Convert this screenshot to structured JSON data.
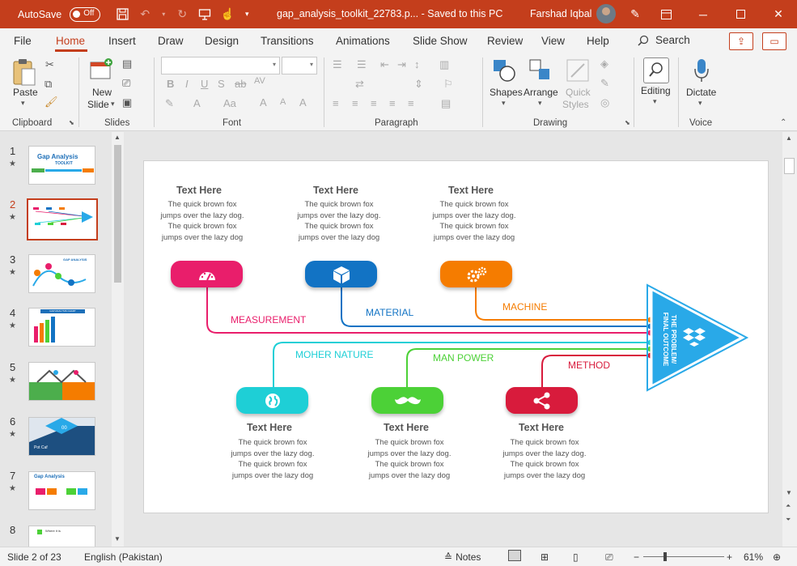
{
  "titlebar": {
    "autosave_label": "AutoSave",
    "autosave_state": "Off",
    "doc_title": "gap_analysis_toolkit_22783.p... - Saved to this PC",
    "user_name": "Farshad Iqbal"
  },
  "menu": {
    "tabs": [
      "File",
      "Home",
      "Insert",
      "Draw",
      "Design",
      "Transitions",
      "Animations",
      "Slide Show",
      "Review",
      "View",
      "Help"
    ],
    "active": "Home",
    "search_label": "Search"
  },
  "ribbon": {
    "clipboard": {
      "paste": "Paste",
      "group": "Clipboard"
    },
    "slides": {
      "new_slide_line1": "New",
      "new_slide_line2": "Slide",
      "group": "Slides"
    },
    "font": {
      "group": "Font"
    },
    "paragraph": {
      "group": "Paragraph"
    },
    "drawing": {
      "shapes": "Shapes",
      "arrange": "Arrange",
      "quick_line1": "Quick",
      "quick_line2": "Styles",
      "group": "Drawing"
    },
    "editing": {
      "label": "Editing"
    },
    "voice": {
      "dictate": "Dictate",
      "group": "Voice"
    }
  },
  "thumbnails": {
    "numbers": [
      "1",
      "2",
      "3",
      "4",
      "5",
      "6",
      "7",
      "8"
    ],
    "active_index": 1,
    "t1_title": "Gap Analysis",
    "t1_sub": "TOOLKIT",
    "t3_title": "GAP ANALYSIS",
    "t4_title": "GAP ANALYSIS CHART",
    "t6_label1": "Pot Caf",
    "t6_label2": "00",
    "t7_title": "Gap Analysis",
    "t8_title": "Where it is"
  },
  "slide": {
    "top_blocks": [
      {
        "heading": "Text Here",
        "body": "The quick brown fox jumps over the lazy dog. The quick brown fox jumps over the lazy dog",
        "color": "#e91e6b",
        "icon": "gauge-icon",
        "category": "MEASUREMENT"
      },
      {
        "heading": "Text Here",
        "body": "The quick brown fox jumps over the lazy dog. The quick brown fox jumps over the lazy dog",
        "color": "#1273c4",
        "icon": "cube-icon",
        "category": "MATERIAL"
      },
      {
        "heading": "Text Here",
        "body": "The quick brown fox jumps over the lazy dog. The quick brown fox jumps over the lazy dog",
        "color": "#f57c00",
        "icon": "gears-icon",
        "category": "MACHINE"
      }
    ],
    "bottom_blocks": [
      {
        "heading": "Text Here",
        "body": "The quick brown fox jumps over the lazy dog. The quick brown fox jumps over the lazy dog",
        "color": "#1ecfd6",
        "icon": "globe-icon",
        "category": "MOHER NATURE"
      },
      {
        "heading": "Text Here",
        "body": "The quick brown fox jumps over the lazy dog. The quick brown fox jumps over the lazy dog",
        "color": "#4cd137",
        "icon": "mustache-icon",
        "category": "MAN POWER"
      },
      {
        "heading": "Text Here",
        "body": "The quick brown fox jumps over the lazy dog. The quick brown fox jumps over the lazy dog",
        "color": "#d81b3c",
        "icon": "share-icon",
        "category": "METHOD"
      }
    ],
    "outcome_line1": "THE PROBLEM/",
    "outcome_line2": "FINAL OUTCOME",
    "outcome_color": "#29a9e8"
  },
  "status": {
    "slide_info": "Slide 2 of 23",
    "language": "English (Pakistan)",
    "notes": "Notes",
    "zoom": "61%"
  }
}
